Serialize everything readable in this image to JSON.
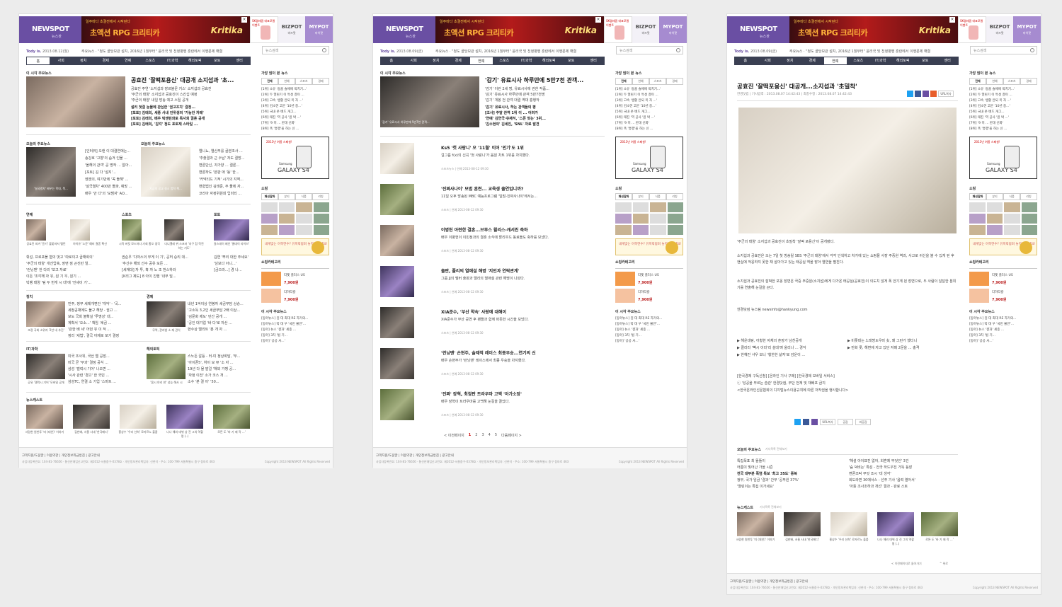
{
  "brand": {
    "logo": "NEWSPOT",
    "logo_sub": "뉴스팟",
    "bizpot": "BIZPOT",
    "bizpot_sub": "비즈팟",
    "mypot": "MYPOT",
    "mypot_sub": "마이팟"
  },
  "banner": {
    "top": "일주마다 초결전에서 시작된다",
    "main": "초액션 RPG 크리티카",
    "brand": "Kritika"
  },
  "ad": {
    "text": "SK텔레콤 대표모델 이벤트"
  },
  "search": {
    "placeholder": "뉴스검색"
  },
  "nav": [
    "홈",
    "사회",
    "정치",
    "경제",
    "연예",
    "스포츠",
    "IT/과학",
    "해외토픽",
    "포토",
    "엔터"
  ],
  "pages": [
    {
      "today_label": "Tody is.",
      "today_date": "2013.08.12(월)",
      "ticker": "주요뉴스 · \"청도 골당보관 설치, 2016년 1월부터\"  윤리국 및 천정병행 혼란에서 이행문제 해결"
    },
    {
      "today_label": "Tody is.",
      "today_date": "2013.08.09(금)",
      "ticker": "주요뉴스 · \"청도 골당보관 설치, 2016년 1월부터\"  윤리국 및 천정병행 혼란에서 이행문제 해결"
    },
    {
      "today_label": "Tody is.",
      "today_date": "2013.08.09(금)",
      "ticker": "주요뉴스 · \"청도 골당보관 설치, 2016년 1월부터\"  윤리국 및 천정병행 혼란에서 이행문제 해결"
    }
  ],
  "home": {
    "section_main": "이 시각 주요뉴스",
    "top_headline": "공효진 '잘떡포용신' 대공개 소지섭과 '초...",
    "top_lines": [
      "공효진 주연 '소지섭과 장르불문 키스' 소지섭과 공효진",
      "'주군의 태양' 소지섭과 공효진이 스킨십 예정",
      "'주군의 태양' 내일 방송 예고 스틸 공개",
      "설리 첫결 눈물에 관심한 '권고조치' 결정...",
      "[포토] 김태희, 세종 사내 인위생의 '가능한 자매'",
      "[포토] 김태희, 배우 틱앤틴화로 특사회 결혼 공개",
      "[포토] 김태희, '감각' 정도 포토재 스타일 ..."
    ],
    "section_left": "오늘의 주요뉴스",
    "section_right": "오늘의 주요뉴스",
    "mid_left_lines": [
      "[인터뷰] 오랜 이 대결연애는...",
      "송강호 '고향'의 숨겨 인물 ...",
      "'올해의 관객' 공 명작 ... 알아...",
      "[포토] 김 다 '설지'...",
      "엔젠의, 여기만에 '꼭 돌해' ...",
      "'설국열차' 400만 돌파, 예망 ...",
      "배우 '안 다'의 '모범자' AO..."
    ],
    "mid_right_lines": [
      "엘니뇨, 열산부를 골본조사 ...",
      "'추출결과 근 수납' 자도 결방...",
      "변론단신, 자가양 ... 결론...",
      "변론하도 '본판 애 '동' 한...",
      "'커넥티드 기적' 시기의 지역...",
      "변협법인 김태준, 주 물에 자...",
      "코리아 자정위원회 입미되 ..."
    ],
    "cap_mid_left": "'설국열차' 배우는 학대, 폭...",
    "cap_mid_right": "지금의 공교 실시 법적 책...",
    "sec_ent": "연예",
    "sec_sport": "스포츠",
    "sec_photo": "포토",
    "ent_caps": [
      "공효진 피겨 '윤기' 불꽃마저 탤런",
      "아이유 '소문' 예비 결혼 확신"
    ],
    "sport_caps": [
      "시작 버킷 모드하다 기회 홍오 생각",
      "다니엘레 뷔 스포터 '지구 참 작전 하는 기도'"
    ],
    "photo_caps": [
      "걸스데이 메인 '쿨데이 라이브'",
      "'쿨스 조사' 결사 실장 신작"
    ],
    "ent_lines": [
      "휘성, 프로포폴 혐의 벗고 '따로의고 급해회의'",
      "'주군의 태양' 개선압축, 장면 점 곤진만 얼...",
      "'런닝맨' 한 다리 '보고 자료'",
      "이든 '조각해 자 유, 원 기 우, 원기 ...",
      "빅뱅 태양 '팀 두 번개 시 대'에 '진세이 기'..."
    ],
    "sport_lines": [
      "권순우 '다저스의 무게 이 기', 공허 승리 대...",
      "'추신수 해외 선수 공유 모든 ...",
      "[세계대] 자 투, 혹 자 노 조 번스하라",
      "[K리그 제도] 8 아이 진행 '내부 밀..."
    ],
    "photo_lines": [
      "김연 '뿌리 대한 주세요'",
      "'남보다 아니...'",
      "[금으라...] 경 나..."
    ],
    "sec_politics": "정치",
    "sec_economy": "경제",
    "politics_cap": "조정 국회 소위자 '2년 내 추진'",
    "economy_cap": "무역, 관리법 소 제 권익",
    "politics_lines": [
      "민주, 정부 세제개편안 '개악' - '국...",
      "세정공채에도 불구 해당 - 권고 ...",
      "보도 국회 불확실 '투명성' 대...",
      "계획서 '오소...' 책임 '세금 ...",
      "'관한 배 세' 어떤 유 이 적 ...",
      "정리 '세법', 결국 아제로 포기 결정"
    ],
    "economy_lines": [
      "내년 1억이상 연봉자 세금부담 상승...",
      "'고소득 3,2인 세금부담 2배 이상...",
      "'김문화 제도' 민간 공개 ...",
      "'공인 대기업 '바 다'로 자산 ...",
      "현수상 엘리트 '분 개 자 ..."
    ],
    "sec_it": "IT/과학",
    "sec_overseas": "해외토픽",
    "it_cap": "공유 '갤럭시 기어' 모바일 공개",
    "overseas_cap": "'몸시 야리 한' 성능 해사 시",
    "it_lines": [
      "미국 조사위, 국산 엘 공장...",
      "미국 곧 '부과' 결정 공식 ...",
      "삼성 '갤럭시 기어' 나오면 ...",
      "'시사 관련 '경고' 한 국민 ...",
      "삼성TC, 연결 소 기업 '스마트 ..."
    ],
    "overseas_lines": [
      "스노든 갈등 - 러-미 정상회담, '부...",
      "'아이폰5', 하이 모 뷰 '소 자 ...",
      "19년 다 몰 발걸 '해외 가맹 공...",
      "'자정 이전' 소가 코스 개 ...",
      "소수 '분 결 이' '50..."
    ],
    "sec_newscast": "뉴스캐스트",
    "newscast_caps": [
      "사람한 원반투 '미 (대안)' 이야기",
      "김한배, 서울 사내 '한국메디'",
      "홍상수 '우리 선희' 로카르노 출품",
      "나나 해외 데뷔 상 진 그의 역할 명 (..)",
      "로튼 도 '바 기 제 작 ...'"
    ]
  },
  "list": {
    "section_main": "이 시각 주요뉴스",
    "top_headline": "'감기' 유료시사 하루만에 5만7천 관객...",
    "top_lines": [
      "'감기' 이런 2세 명, 유료시사에 관한 작품...",
      "'감기' 유료시사 하루만에 관객 5만7천명",
      "'감기' 개봉 전 관객 대결 역대 흥행작",
      "'감기' 유료시사, 하는 관객들의 평",
      "[조사] 주말 관객 1위 이 ... 어려가",
      "'연예' 김연국·유재석, '스폰 맞는' 3위...",
      "'김수현의' 김세진, 'SNL' 자로 발견 "
    ],
    "top_cap": "'감기' 유료시사 하루만에 5만7천 관객...",
    "items": [
      {
        "title": "Ks5 '첫 사랑니' 오 '11월' 이어 '인기'도 1위",
        "desc": "걸그룹 f(x)의 신곡 '첫 사랑니'가 음원 차트 1위를 차지했다.",
        "meta": "스포츠뉴스 | 연예 2013-08-12 09:30"
      },
      {
        "title": "'진짜사나이' 모범 훈련... 교육생 출연입니까?",
        "desc": "11일 오후 방송된 MBC 예능프로그램 '일밤-진짜사나이'에서는...",
        "meta": "스포츠 | 연예 2013-08-12 09:30"
      },
      {
        "title": "이병헌 아련한 결혼...브루스 윌리스-캐서린 축하",
        "desc": "배우 이병헌이 이민정과의 결혼 소식에 할리우드 동료들도 축하를 보냈다.",
        "meta": "스포츠 | 연예 2013-08-12 09:30"
      },
      {
        "title": "출판, 폴리의 열애설 해명 '지인과 연락관계'",
        "desc": "그룹 JJ의 멤버 출판과 엘리의 열애설 관련 해명이 나왔다.",
        "meta": "스포츠 | 연예 2013-08-12 09:30"
      },
      {
        "title": "XIA준수, '부산 약속' 사랑에 대해이",
        "desc": "XIA준수가 부산 공연 후 팬들과 함께 따뜻한 시간을 보냈다.",
        "meta": "스포츠 | 연예 2013-08-12 09:30"
      },
      {
        "title": "'런닝맨' 손현주, 솔제적 레이스 최종우승...연기의 신",
        "desc": "배우 손현주가 '런닝맨' 레이스에서 최종 우승을 차지했다.",
        "meta": "스포츠 | 연예 2013-08-12 09:30"
      },
      {
        "title": "'진짜' 장혁, 최정판 트라우마 고백 '아가소장'",
        "desc": "배우 장혁이 트라우마를 고백해 눈길을 끌었다.",
        "meta": "스포츠 | 연예 2013-08-12 09:30"
      }
    ],
    "pager_prev": "< 이전페이지",
    "pager_pages": [
      "1",
      "2",
      "3",
      "4",
      "5"
    ],
    "pager_next": "다음페이지 >"
  },
  "article": {
    "title": "공효진 '잘떡포용신' 대공개...소지섭과 '초밀착'",
    "meta": "한경닷컴  |  기사입력 : 2013.08.07 14:42:43  |  최종수정 : 2013.08.07 14:42:43",
    "url_btn": "URL복사",
    "caption": "'주군의 태양' 소지섭과 공효진이 초밀착 '잘떡 포용신'이 공개됐다.",
    "p1": "소지섭과 공효진은 오는 7일 첫 방송될 SBS '주군의 태양'에서 각각 인색하고 처가에 있는 쇼핑몰 사장 주중원 역과, 사고로 귀신을 볼 수 있게 된 후 현실에 적응하지 못한 채 살아가고 있는 태공실 역을 맡아 열연을 펼친다.",
    "p2": "소지섭과 공효진의 잘떡한 포옹 장면은 극중 주중원(소지섭)에게 다가온 태공실(공효진)이 의도치 않게 폭 안기게 된 장면으로, 두 사람이 달달한 분위기를 연출해 눈길을 끈다.",
    "credit": "한경닷컴 뉴스팀 newsinfo@hankyung.com",
    "related": [
      "▶ 해운대탕, 어황한 자체의 훈장가 남친공개",
      "▶ 클라라 '빽시 이라'리 설대'며 울리나 ... 경악",
      "▶ 한혜진 샤우 보니 '행한한 삶자'로 감운이 ...",
      "▶ 비롯데는 노래방도우미 女, 왜 그런가 했더니",
      "▶ 만화 롯, 해변에 자고 있던 자매 2문을 ... 충격"
    ],
    "copyright": [
      "[한국경제 구독신청] [온라인 기사 구매] [한국경제 모바일 서비스]",
      "ⓒ '성공을 부르는 습관' 한경닷컴, 무단 전재 및 재배포 금지",
      "<한국온라인신문협회의 디지털뉴스이용규칙에 따른 저작권을 행사합니다>"
    ],
    "like_btn": "공감",
    "nolike_btn": "비공감",
    "today_title": "오늘의 주요뉴스",
    "today_sub": "기사목록 전체보기",
    "today_left": [
      "특집목표 최 뜰뜰이",
      "어름이 빛어난 가을 시즌",
      "전국 대부분 폭염 특보 '최고 35도' 중복",
      "정부, 국가 임금 '결과' 간부 '공무원 37%'",
      "'열린이는 특집 이가세요'"
    ],
    "today_right": [
      "'해설 아이표진 없어, 회혼제 무엇인' 3건",
      "'숨 덕비는' 특성 - 전국 하드우진 가득 등장",
      "변론조탁 무엇 조시 '대 생각'",
      "회도라면 30에서스 - 선주 기사 '음력 열어서'",
      "'아틀 조사조하과 개선' 결과 - 완료 스토"
    ],
    "newscast_title": "뉴스캐스트",
    "newscast_sub": "기사목록 전체보기",
    "back_link": "< 이전페이지로 돌아가기",
    "top_link": "^ 위로"
  },
  "sidebar": {
    "ranking_title": "가장 많이 본 뉴스",
    "tabs": [
      "전체",
      "연예",
      "스포츠",
      "경제"
    ],
    "ranking": [
      "[1위] 소유 '송홈 슬에에 박치기...'",
      "[2위] 두 열린기 이 특성 결이 ...",
      "[3위] 고속 '생활 안되 목 자 ...'",
      "[4위] 김소연 고문 '10년 중...'",
      "[5위] 국내 온 배드 개그...",
      "[6위] 태진 '역 공사 '원 박 ...'",
      "[7위] '9 미 ... 반대 신화'",
      "[8위] 폭 '흥행'을 하는 신 ...",
      "[9위] 여행 세 감소 도 ...",
      "[10위] '2013 아 가 '밴드' ..."
    ],
    "galaxy_tag": "2013년 여름 스페셜!",
    "galaxy_txt": "클릭시, 가격 내손에!",
    "galaxy_brand": "Samsung",
    "galaxy_model": "GALAXY S4",
    "shop_title": "쇼핑",
    "shop_tabs": [
      "패션잡화",
      "뷰티",
      "식품",
      "리빙"
    ],
    "promo": "내게맞는 어학연수? 유학박람회 놓치지 마세요!",
    "hot_title": "쇼핑카테고리",
    "hot_sub": "서울 만원 여행 추석 선물 매출 연대",
    "product1_name": "티켓 플러스 US",
    "product1_price": "7,900원",
    "product2_name": "디하티칼",
    "product2_price": "7,900원",
    "popular_title": "이 시각 주요뉴스",
    "popular": [
      "[동아뉴스] 김 대 최대 RE 자거의...",
      "[동아뉴스] 박 대 우 '국민 불만'...",
      "[동아] 뉴스 '결과' 세종 ...",
      "[동아] 3차 '법 기...",
      "[동아] '공공 사...'",
      "[동아] 경기 공무 ..."
    ]
  },
  "footer": {
    "links": "고객지원/도움말 | 이용약관 | 개인정보취급방침 | 광고안내",
    "info": "사업자등록번호: 104-81-76656 · 통신판매업신고번호: 제2012-서울중구-0378호 · 개인정보관리책임자: 신현석 · 주소: 100-799 서울특별시 중구 청파로 463",
    "copyright": "Copyright 2013 NEWSPOT All Rights Reserved"
  },
  "colors": {
    "brand": "#6a4fa3",
    "nav": "#3a3f52",
    "mypot": "#a68bd0"
  }
}
